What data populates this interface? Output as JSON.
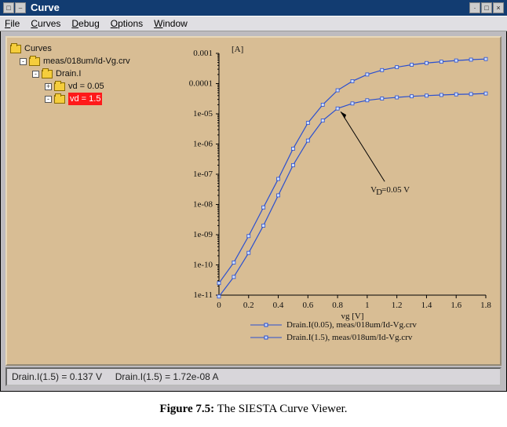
{
  "window": {
    "title": "Curve"
  },
  "menu": {
    "file": "File",
    "curves": "Curves",
    "debug": "Debug",
    "options": "Options",
    "window": "Window"
  },
  "tree": {
    "root": "Curves",
    "file": "meas/018um/Id-Vg.crv",
    "group": "Drain.I",
    "node_vd005": "vd = 0.05",
    "node_vd15": "vd = 1.5"
  },
  "chart_data": {
    "type": "line",
    "title": "",
    "xlabel": "vg [V]",
    "ylabel_unit": "[A]",
    "xticks": [
      0,
      0.2,
      0.4,
      0.6,
      0.8,
      1.0,
      1.2,
      1.4,
      1.6,
      1.8
    ],
    "yticks": [
      "1e-11",
      "1e-10",
      "1e-09",
      "1e-08",
      "1e-07",
      "1e-06",
      "1e-05",
      "0.0001",
      "0.001"
    ],
    "ylim": [
      1e-11,
      0.001
    ],
    "xlim": [
      0,
      1.8
    ],
    "annotation": {
      "text": "V_D=0.05 V",
      "points_to_x": 0.8,
      "points_to_series": 0
    },
    "series": [
      {
        "name": "Drain.I(0.05), meas/018um/Id-Vg.crv",
        "x": [
          0,
          0.1,
          0.2,
          0.3,
          0.4,
          0.5,
          0.6,
          0.7,
          0.8,
          0.9,
          1.0,
          1.1,
          1.2,
          1.3,
          1.4,
          1.5,
          1.6,
          1.7,
          1.8
        ],
        "y": [
          9e-12,
          4e-11,
          2.5e-10,
          2e-09,
          2e-08,
          2e-07,
          1.3e-06,
          6e-06,
          1.5e-05,
          2.2e-05,
          2.8e-05,
          3.2e-05,
          3.5e-05,
          3.8e-05,
          4e-05,
          4.2e-05,
          4.4e-05,
          4.5e-05,
          4.7e-05
        ]
      },
      {
        "name": "Drain.I(1.5), meas/018um/Id-Vg.crv",
        "x": [
          0,
          0.1,
          0.2,
          0.3,
          0.4,
          0.5,
          0.6,
          0.7,
          0.8,
          0.9,
          1.0,
          1.1,
          1.2,
          1.3,
          1.4,
          1.5,
          1.6,
          1.7,
          1.8
        ],
        "y": [
          2.5e-11,
          1.2e-10,
          9e-10,
          8e-09,
          7e-08,
          7e-07,
          5e-06,
          2e-05,
          6e-05,
          0.00012,
          0.0002,
          0.00028,
          0.00035,
          0.00042,
          0.00048,
          0.00053,
          0.00058,
          0.00062,
          0.00065
        ]
      }
    ]
  },
  "legend": {
    "s0": "Drain.I(0.05), meas/018um/Id-Vg.crv",
    "s1": "Drain.I(1.5), meas/018um/Id-Vg.crv"
  },
  "status": {
    "left": "Drain.I(1.5) = 0.137 V",
    "right": "Drain.I(1.5) = 1.72e-08 A"
  },
  "caption": {
    "label": "Figure 7.5:",
    "text": "The SIESTA Curve Viewer."
  }
}
